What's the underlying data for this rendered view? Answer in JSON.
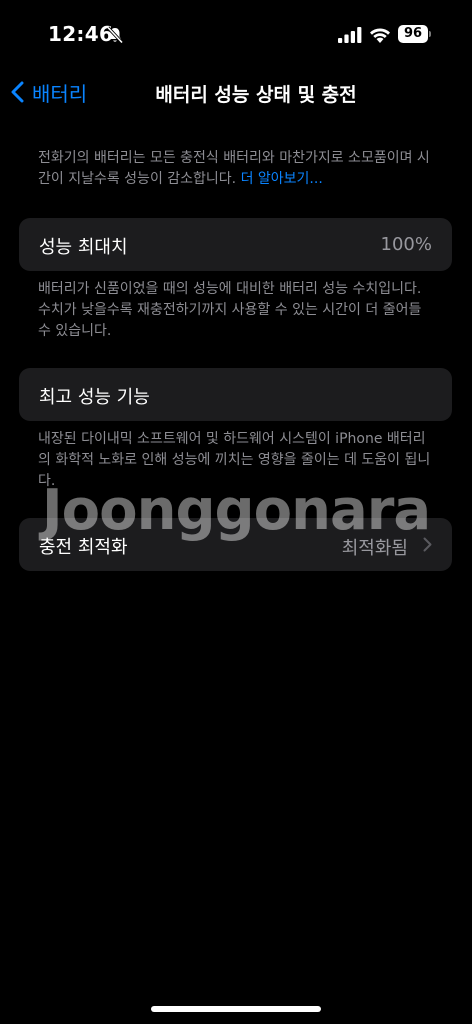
{
  "status_bar": {
    "time": "12:46",
    "battery_level": "96",
    "icons": [
      "bell-slash-icon",
      "cellular-signal-icon",
      "wifi-icon",
      "battery-icon"
    ]
  },
  "nav": {
    "back_label": "배터리",
    "title": "배터리 성능 상태 및 충전",
    "accent_color": "#0a84ff"
  },
  "intro": {
    "text": "전화기의 배터리는 모든 충전식 배터리와 마찬가지로 소모품이며 시간이 지날수록 성능이 감소합니다. ",
    "link": "더 알아보기..."
  },
  "max_capacity": {
    "label": "성능 최대치",
    "value": "100%",
    "footer": "배터리가 신품이었을 때의 성능에 대비한 배터리 성능 수치입니다. 수치가 낮을수록 재충전하기까지 사용할 수 있는 시간이 더 줄어들 수 있습니다."
  },
  "peak_performance": {
    "label": "최고 성능 기능",
    "footer": "내장된 다이내믹 소프트웨어 및 하드웨어 시스템이 iPhone 배터리의 화학적 노화로 인해 성능에 끼치는 영향을 줄이는 데 도움이 됩니다."
  },
  "charging_optimization": {
    "label": "충전 최적화",
    "value": "최적화됨"
  },
  "watermark": "Joonggonara"
}
